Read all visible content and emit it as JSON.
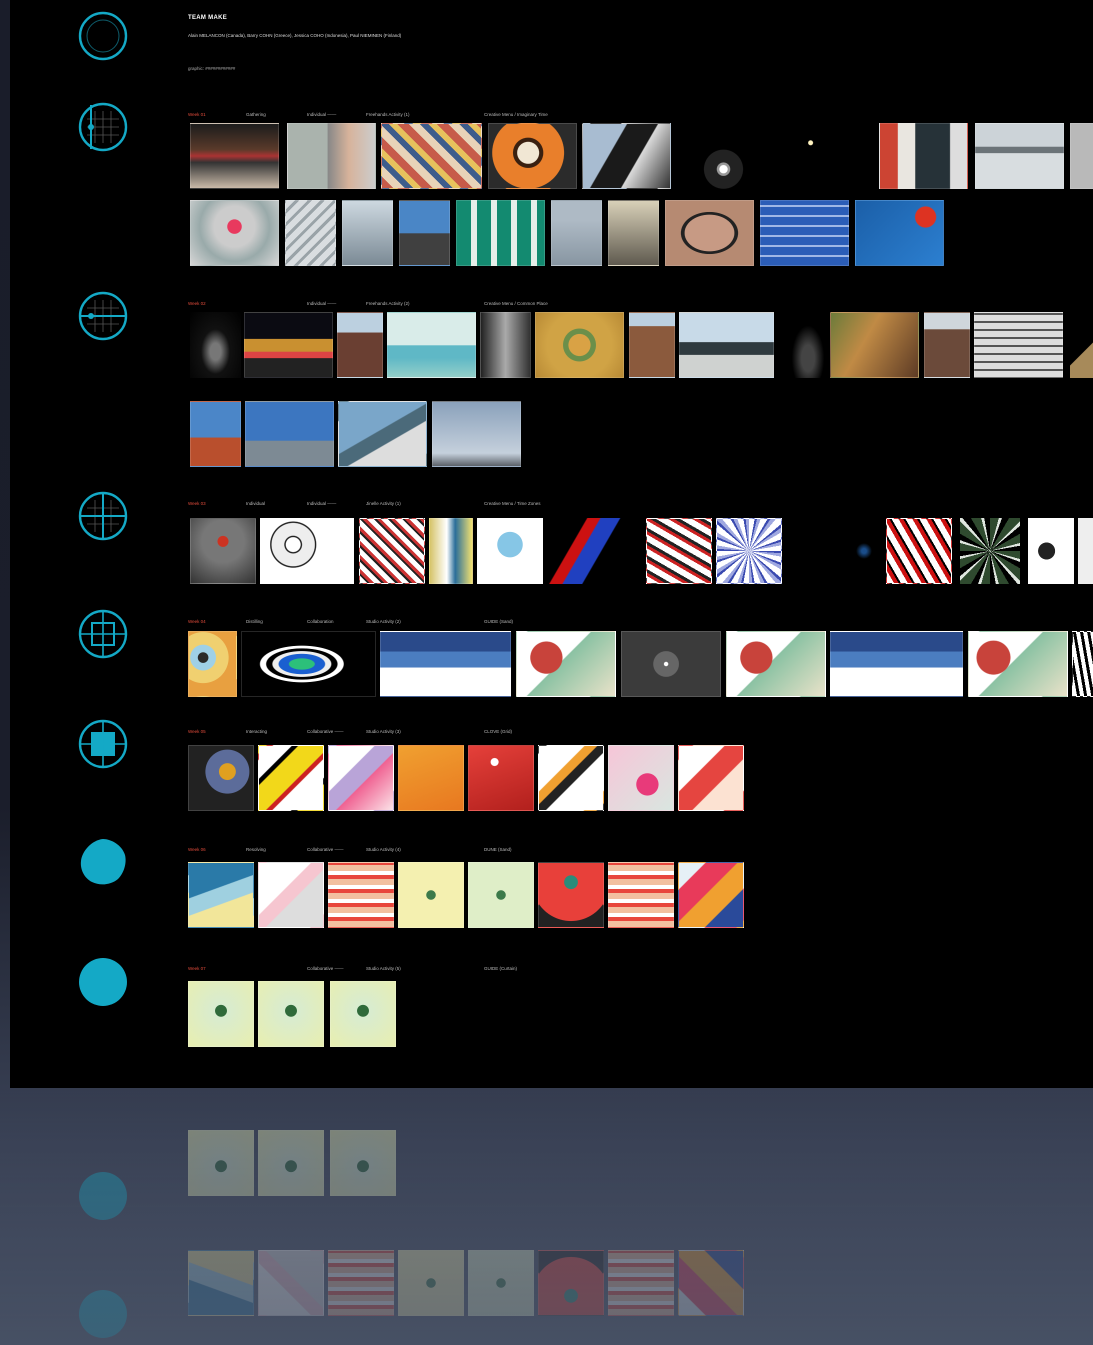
{
  "header": {
    "title": "TEAM MAKE",
    "members": "Alain MELANCON (Canada), Barry COHN (Greece), Jessica COHO (Indonesia), Paul NIEMINEN (Finland)",
    "meta": "graphic: ############"
  },
  "colors": {
    "accent": "#14a9c6",
    "background": "#000000",
    "label_highlight": "#e24b3b"
  },
  "sections": [
    {
      "icon": "circle-grid-crosshair-icon",
      "labels": [
        "Week 01",
        "Gathering",
        "Individual ——",
        "Freehands Activity (1)",
        "Creative Menu / Imaginary Time"
      ]
    },
    {
      "icon": "circle-grid-horizontal-icon",
      "labels": [
        "Week 02",
        "Individual ——",
        "Freehands Activity (2)",
        "Creative Menu / Common Place"
      ]
    },
    {
      "icon": "circle-grid-vertical-icon",
      "labels": [
        "Week 03",
        "Individual",
        "Individual ——",
        "Jinelle Activity (1)",
        "Creative Menu / Time Zones"
      ]
    },
    {
      "icon": "circle-grid-square-icon",
      "labels": [
        "Week 04",
        "Distilling",
        "Collaboration",
        "Studio Activity (2)",
        "GUIDE (Sand)"
      ]
    },
    {
      "icon": "circle-filled-square-icon",
      "labels": [
        "Week 05",
        "Interacting",
        "Collaborative ——",
        "Studio Activity (3)",
        "CLOVE (Grid)"
      ]
    },
    {
      "icon": "circle-filled-rough-icon",
      "labels": [
        "Week 06",
        "Resolving",
        "Collaborative ——",
        "Studio Activity (4)",
        "DUNE (Sand)"
      ]
    },
    {
      "icon": "circle-filled-icon",
      "labels": [
        "Week 07",
        "Collaborative ——",
        "Studio Activity (5)",
        "GUIDE (Curtain)"
      ]
    }
  ]
}
